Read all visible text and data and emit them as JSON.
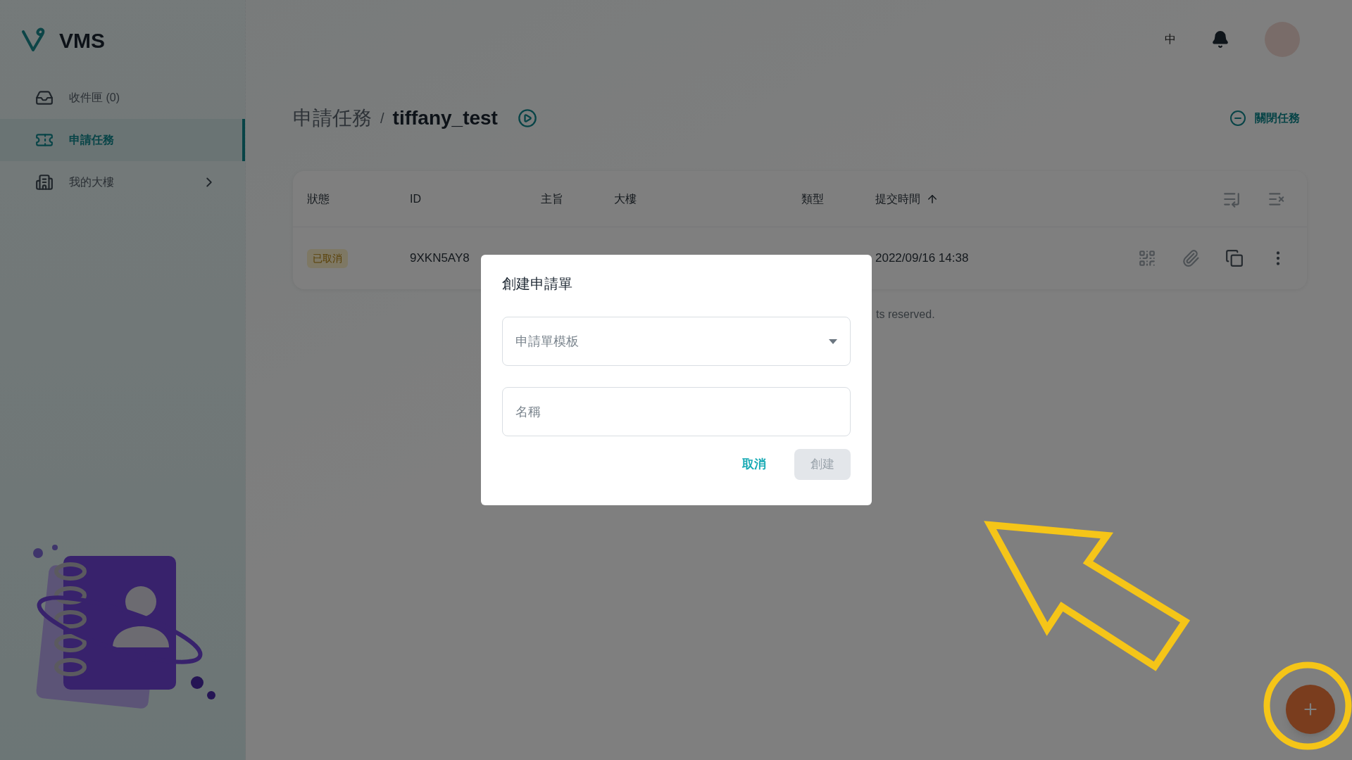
{
  "app": {
    "name": "VMS"
  },
  "sidebar": {
    "items": [
      {
        "label": "收件匣 (0)",
        "selected": false,
        "has_submenu": false
      },
      {
        "label": "申請任務",
        "selected": true,
        "has_submenu": false
      },
      {
        "label": "我的大樓",
        "selected": false,
        "has_submenu": true
      }
    ]
  },
  "header": {
    "language": "中"
  },
  "breadcrumb": {
    "parent": "申請任務",
    "separator": "/",
    "current": "tiffany_test"
  },
  "close_task": {
    "label": "關閉任務"
  },
  "table": {
    "columns": [
      {
        "label": "狀態",
        "sorted": false
      },
      {
        "label": "ID",
        "sorted": false
      },
      {
        "label": "主旨",
        "sorted": false
      },
      {
        "label": "大樓",
        "sorted": false
      },
      {
        "label": "類型",
        "sorted": false
      },
      {
        "label": "提交時間",
        "sorted": true
      }
    ],
    "rows": [
      {
        "status": "已取消",
        "id": "9XKN5AY8",
        "submitted": "2022/09/16 14:38"
      }
    ]
  },
  "footer": {
    "text": "ts reserved."
  },
  "dialog": {
    "title": "創建申請單",
    "template_select": {
      "placeholder": "申請單模板"
    },
    "name_field": {
      "placeholder": "名稱"
    },
    "cancel": {
      "label": "取消"
    },
    "create": {
      "label": "創建",
      "disabled": true
    }
  }
}
